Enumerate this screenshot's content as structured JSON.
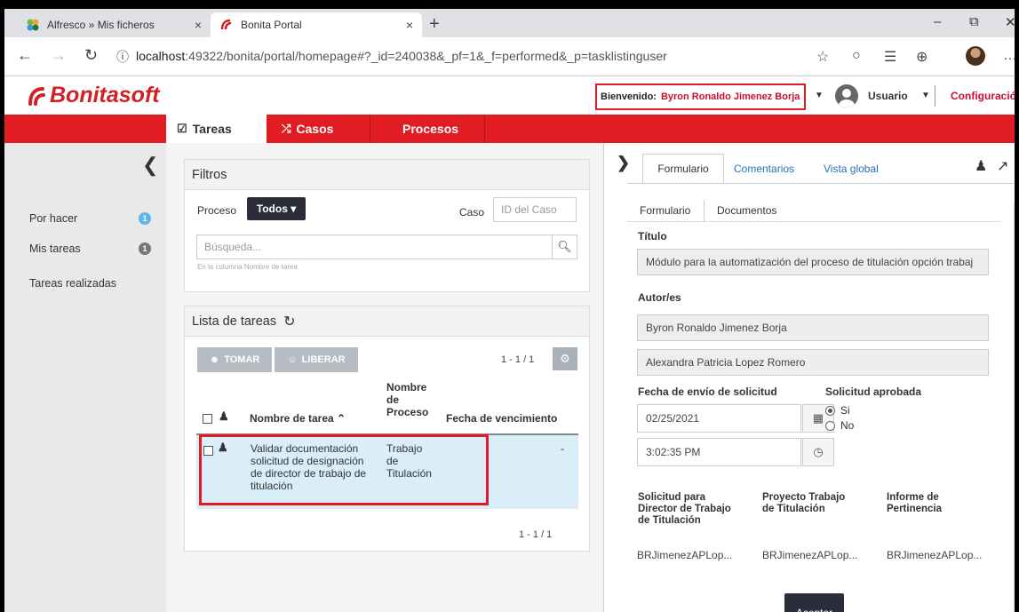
{
  "browser": {
    "tabs": [
      {
        "title": "Alfresco » Mis ficheros"
      },
      {
        "title": "Bonita Portal"
      }
    ],
    "close_glyph": "×",
    "new_tab_glyph": "+",
    "url_host": "localhost",
    "url_path": ":49322/bonita/portal/homepage#?_id=240038&_pf=1&_f=performed&_p=tasklistinguser",
    "window_controls": [
      "–",
      "⧉",
      "✕"
    ]
  },
  "header": {
    "logo_text": "Bonitasoft",
    "welcome_label": "Bienvenido:",
    "welcome_name": "Byron Ronaldo Jimenez Borja",
    "user_label": "Usuario",
    "config_label": "Configuración"
  },
  "nav": {
    "tabs": [
      {
        "label": "Tareas",
        "icon": "checkbox-icon"
      },
      {
        "label": "Casos",
        "icon": "shuffle-icon"
      },
      {
        "label": "Procesos"
      }
    ],
    "active_tab": "Tareas"
  },
  "sidebar": {
    "collapse_glyph": "❮",
    "items": [
      {
        "label": "Por hacer",
        "count": "1",
        "badge_color": "#5bb8e8"
      },
      {
        "label": "Mis tareas",
        "count": "1",
        "badge_color": "#777777"
      },
      {
        "label": "Tareas realizadas"
      }
    ]
  },
  "filters": {
    "title": "Filtros",
    "process_label": "Proceso",
    "process_value": "Todos ▾",
    "case_label": "Caso",
    "case_placeholder": "ID del Caso",
    "search_placeholder": "Búsqueda...",
    "search_hint": "En la columna Nombre de tarea"
  },
  "tasklist": {
    "title": "Lista de tareas",
    "take_label": "TOMAR",
    "release_label": "LIBERAR",
    "pager_top": "1 - 1 / 1",
    "pager_bottom": "1 - 1 / 1",
    "columns": {
      "task_name": "Nombre de tarea",
      "process_name": [
        "Nombre",
        "de",
        "Proceso"
      ],
      "due_date": "Fecha de vencimiento"
    },
    "sort_glyph": "⌃",
    "rows": [
      {
        "task_name": [
          "Validar documentación",
          "solicitud de designación",
          "de director de trabajo de",
          "titulación"
        ],
        "process_name": [
          "Trabajo",
          "de",
          "Titulación"
        ],
        "due_date": "-"
      }
    ]
  },
  "form_pane": {
    "tabs": [
      "Formulario",
      "Comentarios",
      "Vista global"
    ],
    "active_tab": "Formulario",
    "subtabs": [
      "Formulario",
      "Documentos"
    ],
    "titulo_label": "Título",
    "titulo_value": "Módulo para la automatización del proceso de titulación opción trabaj",
    "autores_label": "Autor/es",
    "autores": [
      "Byron Ronaldo Jimenez Borja",
      "Alexandra Patricia  Lopez Romero"
    ],
    "fecha_label": "Fecha de envío de solicitud",
    "fecha_value": "02/25/2021",
    "hora_value": "3:02:35 PM",
    "aprobada_label": "Solicitud aprobada",
    "aprobada_options": [
      "Si",
      "No"
    ],
    "aprobada_selected": "Si",
    "documents": [
      {
        "title": [
          "Solicitud para",
          "Director de Trabajo",
          "de Titulación"
        ],
        "file": "BRJimenezAPLop..."
      },
      {
        "title": [
          "Proyecto Trabajo",
          "de Titulación"
        ],
        "file": "BRJimenezAPLop..."
      },
      {
        "title": [
          "Informe de",
          "Pertinencia"
        ],
        "file": "BRJimenezAPLop..."
      }
    ],
    "accept_label": "Aceptar"
  },
  "colors": {
    "brand_red": "#e11c23",
    "dark_button": "#2b2e3a",
    "selected_row": "#d9eef8",
    "highlight_box": "#e01b24"
  }
}
